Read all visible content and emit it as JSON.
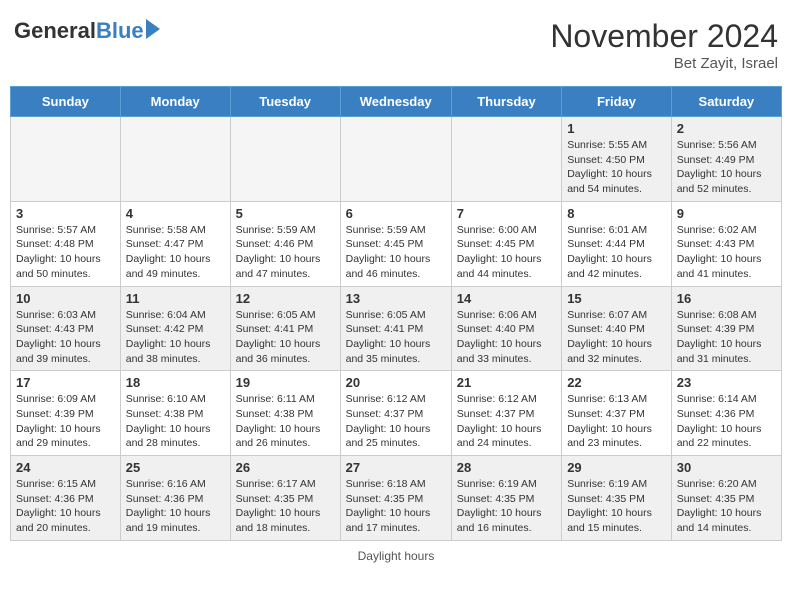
{
  "header": {
    "logo_general": "General",
    "logo_blue": "Blue",
    "month_title": "November 2024",
    "location": "Bet Zayit, Israel"
  },
  "days_of_week": [
    "Sunday",
    "Monday",
    "Tuesday",
    "Wednesday",
    "Thursday",
    "Friday",
    "Saturday"
  ],
  "footer": {
    "daylight_hours": "Daylight hours"
  },
  "weeks": [
    {
      "days": [
        {
          "num": "",
          "empty": true
        },
        {
          "num": "",
          "empty": true
        },
        {
          "num": "",
          "empty": true
        },
        {
          "num": "",
          "empty": true
        },
        {
          "num": "",
          "empty": true
        },
        {
          "num": "1",
          "info": "Sunrise: 5:55 AM\nSunset: 4:50 PM\nDaylight: 10 hours and 54 minutes."
        },
        {
          "num": "2",
          "info": "Sunrise: 5:56 AM\nSunset: 4:49 PM\nDaylight: 10 hours and 52 minutes."
        }
      ]
    },
    {
      "days": [
        {
          "num": "3",
          "info": "Sunrise: 5:57 AM\nSunset: 4:48 PM\nDaylight: 10 hours and 50 minutes."
        },
        {
          "num": "4",
          "info": "Sunrise: 5:58 AM\nSunset: 4:47 PM\nDaylight: 10 hours and 49 minutes."
        },
        {
          "num": "5",
          "info": "Sunrise: 5:59 AM\nSunset: 4:46 PM\nDaylight: 10 hours and 47 minutes."
        },
        {
          "num": "6",
          "info": "Sunrise: 5:59 AM\nSunset: 4:45 PM\nDaylight: 10 hours and 46 minutes."
        },
        {
          "num": "7",
          "info": "Sunrise: 6:00 AM\nSunset: 4:45 PM\nDaylight: 10 hours and 44 minutes."
        },
        {
          "num": "8",
          "info": "Sunrise: 6:01 AM\nSunset: 4:44 PM\nDaylight: 10 hours and 42 minutes."
        },
        {
          "num": "9",
          "info": "Sunrise: 6:02 AM\nSunset: 4:43 PM\nDaylight: 10 hours and 41 minutes."
        }
      ]
    },
    {
      "days": [
        {
          "num": "10",
          "info": "Sunrise: 6:03 AM\nSunset: 4:43 PM\nDaylight: 10 hours and 39 minutes."
        },
        {
          "num": "11",
          "info": "Sunrise: 6:04 AM\nSunset: 4:42 PM\nDaylight: 10 hours and 38 minutes."
        },
        {
          "num": "12",
          "info": "Sunrise: 6:05 AM\nSunset: 4:41 PM\nDaylight: 10 hours and 36 minutes."
        },
        {
          "num": "13",
          "info": "Sunrise: 6:05 AM\nSunset: 4:41 PM\nDaylight: 10 hours and 35 minutes."
        },
        {
          "num": "14",
          "info": "Sunrise: 6:06 AM\nSunset: 4:40 PM\nDaylight: 10 hours and 33 minutes."
        },
        {
          "num": "15",
          "info": "Sunrise: 6:07 AM\nSunset: 4:40 PM\nDaylight: 10 hours and 32 minutes."
        },
        {
          "num": "16",
          "info": "Sunrise: 6:08 AM\nSunset: 4:39 PM\nDaylight: 10 hours and 31 minutes."
        }
      ]
    },
    {
      "days": [
        {
          "num": "17",
          "info": "Sunrise: 6:09 AM\nSunset: 4:39 PM\nDaylight: 10 hours and 29 minutes."
        },
        {
          "num": "18",
          "info": "Sunrise: 6:10 AM\nSunset: 4:38 PM\nDaylight: 10 hours and 28 minutes."
        },
        {
          "num": "19",
          "info": "Sunrise: 6:11 AM\nSunset: 4:38 PM\nDaylight: 10 hours and 26 minutes."
        },
        {
          "num": "20",
          "info": "Sunrise: 6:12 AM\nSunset: 4:37 PM\nDaylight: 10 hours and 25 minutes."
        },
        {
          "num": "21",
          "info": "Sunrise: 6:12 AM\nSunset: 4:37 PM\nDaylight: 10 hours and 24 minutes."
        },
        {
          "num": "22",
          "info": "Sunrise: 6:13 AM\nSunset: 4:37 PM\nDaylight: 10 hours and 23 minutes."
        },
        {
          "num": "23",
          "info": "Sunrise: 6:14 AM\nSunset: 4:36 PM\nDaylight: 10 hours and 22 minutes."
        }
      ]
    },
    {
      "days": [
        {
          "num": "24",
          "info": "Sunrise: 6:15 AM\nSunset: 4:36 PM\nDaylight: 10 hours and 20 minutes."
        },
        {
          "num": "25",
          "info": "Sunrise: 6:16 AM\nSunset: 4:36 PM\nDaylight: 10 hours and 19 minutes."
        },
        {
          "num": "26",
          "info": "Sunrise: 6:17 AM\nSunset: 4:35 PM\nDaylight: 10 hours and 18 minutes."
        },
        {
          "num": "27",
          "info": "Sunrise: 6:18 AM\nSunset: 4:35 PM\nDaylight: 10 hours and 17 minutes."
        },
        {
          "num": "28",
          "info": "Sunrise: 6:19 AM\nSunset: 4:35 PM\nDaylight: 10 hours and 16 minutes."
        },
        {
          "num": "29",
          "info": "Sunrise: 6:19 AM\nSunset: 4:35 PM\nDaylight: 10 hours and 15 minutes."
        },
        {
          "num": "30",
          "info": "Sunrise: 6:20 AM\nSunset: 4:35 PM\nDaylight: 10 hours and 14 minutes."
        }
      ]
    }
  ]
}
